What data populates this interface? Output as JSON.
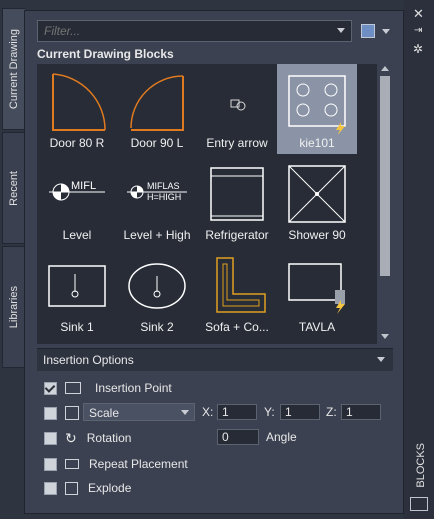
{
  "side_tabs": [
    {
      "label": "Current Drawing"
    },
    {
      "label": "Recent"
    },
    {
      "label": "Libraries"
    }
  ],
  "filter": {
    "placeholder": "Filter..."
  },
  "section_title": "Current Drawing Blocks",
  "blocks": [
    {
      "label": "Door 80 R"
    },
    {
      "label": "Door 90 L"
    },
    {
      "label": "Entry arrow"
    },
    {
      "label": "kie101"
    },
    {
      "label": "Level"
    },
    {
      "label": "Level + High"
    },
    {
      "label": "Refrigerator"
    },
    {
      "label": "Shower 90"
    },
    {
      "label": "Sink 1"
    },
    {
      "label": "Sink 2"
    },
    {
      "label": "Sofa + Co..."
    },
    {
      "label": "TAVLA"
    }
  ],
  "insertion": {
    "title": "Insertion Options",
    "insertion_point": "Insertion Point",
    "scale_select": "Scale",
    "x_label": "X:",
    "x_value": "1",
    "y_label": "Y:",
    "y_value": "1",
    "z_label": "Z:",
    "z_value": "1",
    "rotation": "Rotation",
    "angle_value": "0",
    "angle_label": "Angle",
    "repeat": "Repeat Placement",
    "explode": "Explode"
  },
  "palette_title": "BLOCKS",
  "level_symbol_text": "MIFL",
  "level_high_text_1": "MIFLAS",
  "level_high_text_2": "H=HIGH"
}
